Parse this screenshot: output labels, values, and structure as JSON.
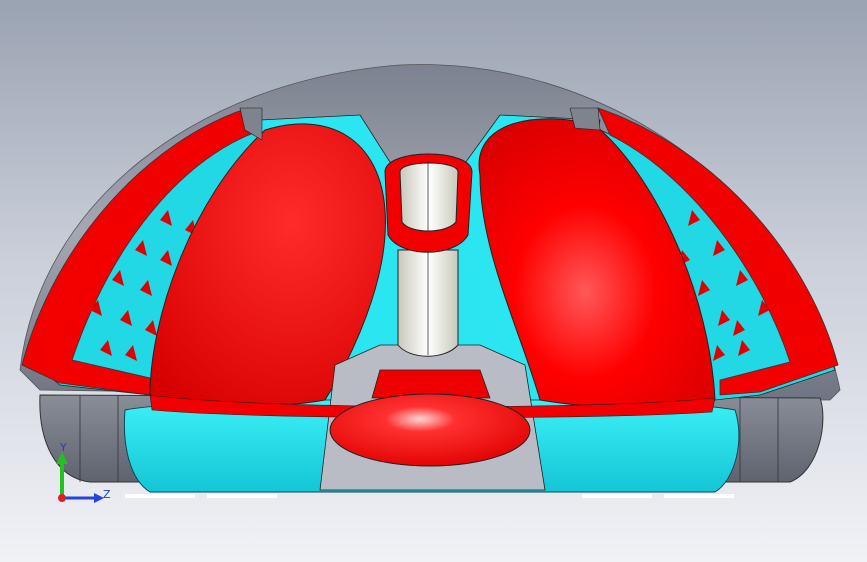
{
  "viewport": {
    "colors": {
      "background_top": "#9aa3b2",
      "background_bottom": "#f1f2f6",
      "shell_gray": "#8d919b",
      "red_surface": "#ff0000",
      "cyan_surface": "#22e5ef",
      "white_surface": "#f4f4ec"
    }
  },
  "triad": {
    "y_label": "Y",
    "z_label": "Z",
    "colors": {
      "y_axis": "#22c022",
      "z_axis": "#2244dd",
      "origin": "#e02020"
    }
  }
}
